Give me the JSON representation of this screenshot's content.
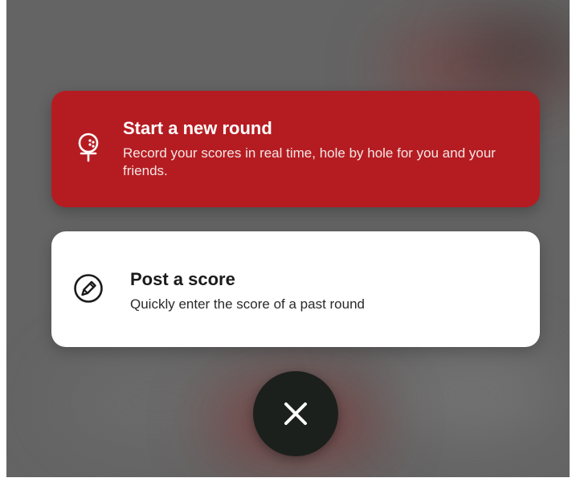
{
  "menu": {
    "start_round": {
      "title": "Start a new round",
      "description": "Record your scores in real time, hole by hole for you and your friends.",
      "icon": "golf-ball-on-tee-icon",
      "background": "#b51c21",
      "text_color": "#ffffff"
    },
    "post_score": {
      "title": "Post a score",
      "description": "Quickly enter the score of a past round",
      "icon": "pencil-edit-icon",
      "background": "#ffffff",
      "text_color": "#1b1b1b"
    }
  },
  "close_button": {
    "icon": "close-icon",
    "background": "#1c201d"
  },
  "overlay": {
    "background": "#646464"
  }
}
